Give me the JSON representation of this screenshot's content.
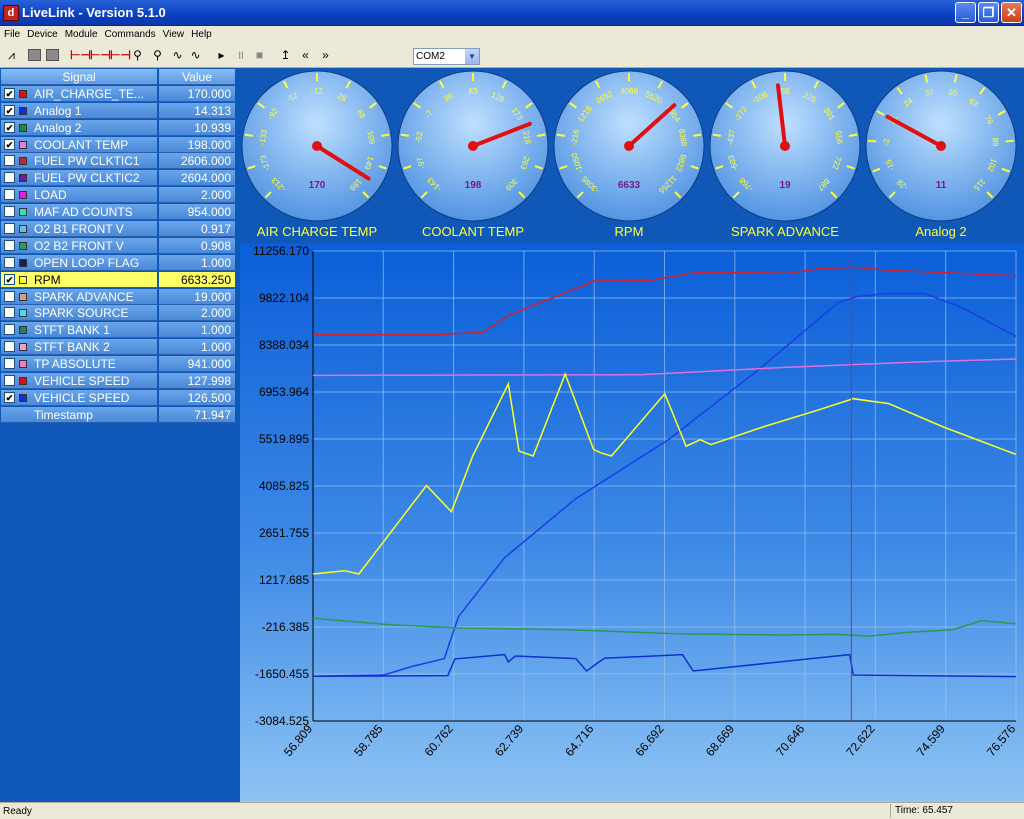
{
  "window": {
    "title": "LiveLink - Version 5.1.0"
  },
  "menu": [
    "File",
    "Device",
    "Module",
    "Commands",
    "View",
    "Help"
  ],
  "toolbar": {
    "com_port": "COM2"
  },
  "signal_table": {
    "header": {
      "signal": "Signal",
      "value": "Value"
    },
    "rows": [
      {
        "name": "AIR_CHARGE_TE...",
        "value": "170.000",
        "checked": true,
        "color": "#e01010"
      },
      {
        "name": "Analog 1",
        "value": "14.313",
        "checked": true,
        "color": "#1030e0"
      },
      {
        "name": "Analog 2",
        "value": "10.939",
        "checked": true,
        "color": "#109040"
      },
      {
        "name": "COOLANT TEMP",
        "value": "198.000",
        "checked": true,
        "color": "#e080e0"
      },
      {
        "name": "FUEL PW CLKTIC1",
        "value": "2606.000",
        "checked": false,
        "color": "#b03030"
      },
      {
        "name": "FUEL PW CLKTIC2",
        "value": "2604.000",
        "checked": false,
        "color": "#6020a0"
      },
      {
        "name": "LOAD",
        "value": "2.000",
        "checked": false,
        "color": "#e020e0"
      },
      {
        "name": "MAF AD COUNTS",
        "value": "954.000",
        "checked": false,
        "color": "#30e0c0"
      },
      {
        "name": "O2 B1 FRONT V",
        "value": "0.917",
        "checked": false,
        "color": "#60c0f0"
      },
      {
        "name": "O2 B2 FRONT V",
        "value": "0.908",
        "checked": false,
        "color": "#20a060"
      },
      {
        "name": "OPEN LOOP FLAG",
        "value": "1.000",
        "checked": false,
        "color": "#102060"
      },
      {
        "name": "RPM",
        "value": "6633.250",
        "checked": true,
        "color": "#ffff20",
        "selected": true
      },
      {
        "name": "SPARK ADVANCE",
        "value": "19.000",
        "checked": false,
        "color": "#d0a080"
      },
      {
        "name": "SPARK SOURCE",
        "value": "2.000",
        "checked": false,
        "color": "#40e0f0"
      },
      {
        "name": "STFT BANK 1",
        "value": "1.000",
        "checked": false,
        "color": "#208060"
      },
      {
        "name": "STFT BANK 2",
        "value": "1.000",
        "checked": false,
        "color": "#f0a0c0"
      },
      {
        "name": "TP ABSOLUTE",
        "value": "941.000",
        "checked": false,
        "color": "#f080c0"
      },
      {
        "name": "VEHICLE SPEED",
        "value": "127.998",
        "checked": false,
        "color": "#e01010"
      },
      {
        "name": "VEHICLE SPEED",
        "value": "126.500",
        "checked": true,
        "color": "#1030e0"
      }
    ],
    "timestamp": {
      "name": "Timestamp",
      "value": "71.947"
    }
  },
  "gauges": [
    {
      "label": "AIR CHARGE TEMP",
      "value": 170,
      "value_text": "170",
      "ticks": [
        "-213",
        "-173",
        "-133",
        "-92",
        "-52",
        "-12",
        "28",
        "68",
        "109",
        "149",
        "189"
      ]
    },
    {
      "label": "COOLANT TEMP",
      "value": 198,
      "value_text": "198",
      "ticks": [
        "-143",
        "-97",
        "-52",
        "-7",
        "38",
        "83",
        "128",
        "173",
        "218",
        "263",
        "309"
      ]
    },
    {
      "label": "RPM",
      "value": 6633,
      "value_text": "6633",
      "ticks": [
        "-3085",
        "-1050",
        "-216",
        "1218",
        "2652",
        "4086",
        "5520",
        "6954",
        "8388",
        "9822",
        "11256"
      ]
    },
    {
      "label": "SPARK ADVANCE",
      "value": 19,
      "value_text": "19",
      "ticks": [
        "-768",
        "-603",
        "-437",
        "-272",
        "-106",
        "59",
        "225",
        "391",
        "556",
        "722",
        "887"
      ]
    },
    {
      "label": "Analog 2",
      "value": 11,
      "value_text": "11",
      "ticks": [
        "-28",
        "-15",
        "-2",
        "11",
        "24",
        "37",
        "50",
        "63",
        "76",
        "89",
        "102",
        "115"
      ]
    }
  ],
  "chart_data": {
    "type": "line",
    "x_ticks": [
      "56.809",
      "58.785",
      "60.762",
      "62.739",
      "64.716",
      "66.692",
      "68.669",
      "70.646",
      "72.622",
      "74.599",
      "76.576"
    ],
    "y_ticks": [
      "11256.170",
      "9822.104",
      "8388.034",
      "6953.964",
      "5519.895",
      "4085.825",
      "2651.755",
      "1217.685",
      "-216.385",
      "-1650.455",
      "-3084.525"
    ],
    "xlim": [
      56.809,
      76.576
    ],
    "ylim": [
      -3084.525,
      11256.17
    ],
    "cursor_x": 71.947,
    "grid": true,
    "series": [
      {
        "color": "#d02030",
        "x": [
          56.809,
          60.3,
          61.6,
          62.3,
          64.8,
          66.3,
          67.6,
          70.2,
          71.0,
          72.0,
          73.0,
          76.576
        ],
        "y": [
          8700,
          8700,
          8780,
          9290,
          10370,
          10360,
          10610,
          10580,
          10710,
          10760,
          10670,
          10500
        ]
      },
      {
        "color": "#1a3ee8",
        "x": [
          56.809,
          58.8,
          59.6,
          60.5,
          60.9,
          62.2,
          64.2,
          66.8,
          69.3,
          71.6,
          72.1,
          72.9,
          74.0,
          75.0,
          76.576
        ],
        "y": [
          -1720,
          -1680,
          -1420,
          -1180,
          100,
          1900,
          3700,
          5500,
          7600,
          9700,
          9860,
          9960,
          9960,
          9560,
          8650
        ]
      },
      {
        "color": "#e070e0",
        "x": [
          56.809,
          66.0,
          70.0,
          74.0,
          76.576
        ],
        "y": [
          7460,
          7480,
          7700,
          7880,
          7960
        ]
      },
      {
        "color": "#ffff20",
        "x": [
          56.809,
          57.7,
          58.1,
          60.0,
          60.7,
          61.3,
          62.3,
          62.6,
          63.0,
          63.9,
          64.7,
          64.9,
          65.2,
          66.7,
          67.3,
          67.7,
          68.0,
          69.5,
          71.0,
          72.0,
          73.0,
          74.5,
          76.576
        ],
        "y": [
          1400,
          1500,
          1400,
          4100,
          3300,
          5000,
          7200,
          5150,
          5000,
          7500,
          5200,
          5100,
          5000,
          6900,
          5300,
          5500,
          5350,
          5900,
          6400,
          6750,
          6600,
          5900,
          5050
        ]
      },
      {
        "color": "#2a9a50",
        "x": [
          56.809,
          59.0,
          61.0,
          64.0,
          67.0,
          70.0,
          71.5,
          72.4,
          73.5,
          74.8,
          75.6,
          76.576
        ],
        "y": [
          50,
          -150,
          -250,
          -300,
          -420,
          -460,
          -440,
          -500,
          -380,
          -300,
          -20,
          -120
        ]
      },
      {
        "color": "#1030d0",
        "x": [
          56.809,
          60.6,
          60.8,
          62.2,
          62.3,
          62.5,
          64.2,
          64.5,
          65.0,
          67.2,
          67.5,
          71.9,
          72.0,
          76.576
        ],
        "y": [
          -1720,
          -1700,
          -1190,
          -1060,
          -1280,
          -1100,
          -1180,
          -1560,
          -1170,
          -1060,
          -1560,
          -1060,
          -1680,
          -1730
        ]
      }
    ]
  },
  "status": {
    "left": "Ready",
    "right": "Time: 65.457"
  }
}
